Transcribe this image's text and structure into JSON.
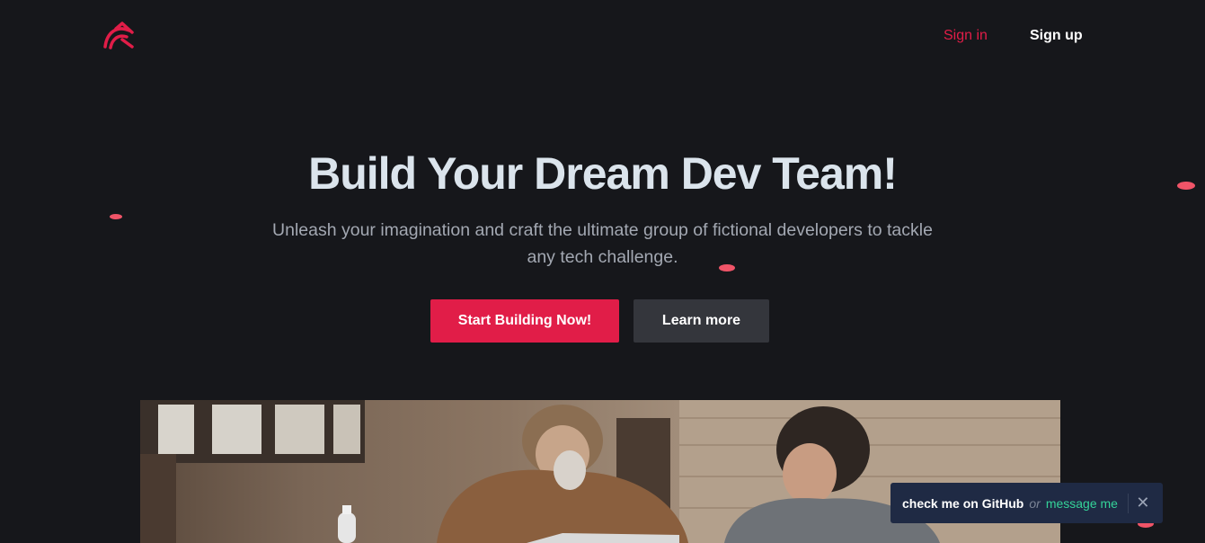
{
  "nav": {
    "logo": "logo-icon",
    "sign_in": "Sign in",
    "sign_up": "Sign up"
  },
  "hero": {
    "title": "Build Your Dream Dev Team!",
    "subtitle": "Unleash your imagination and craft the ultimate group of fictional developers to tackle any tech challenge.",
    "primary_button": "Start Building Now!",
    "secondary_button": "Learn more"
  },
  "toast": {
    "github": "check me on GitHub",
    "or": "or",
    "message": "message me",
    "close_icon": "close-icon"
  },
  "colors": {
    "background": "#16171b",
    "accent": "#e11d48",
    "heading": "#dbe4ec",
    "toast_bg": "#1f2a44",
    "toast_link": "#34d399"
  }
}
